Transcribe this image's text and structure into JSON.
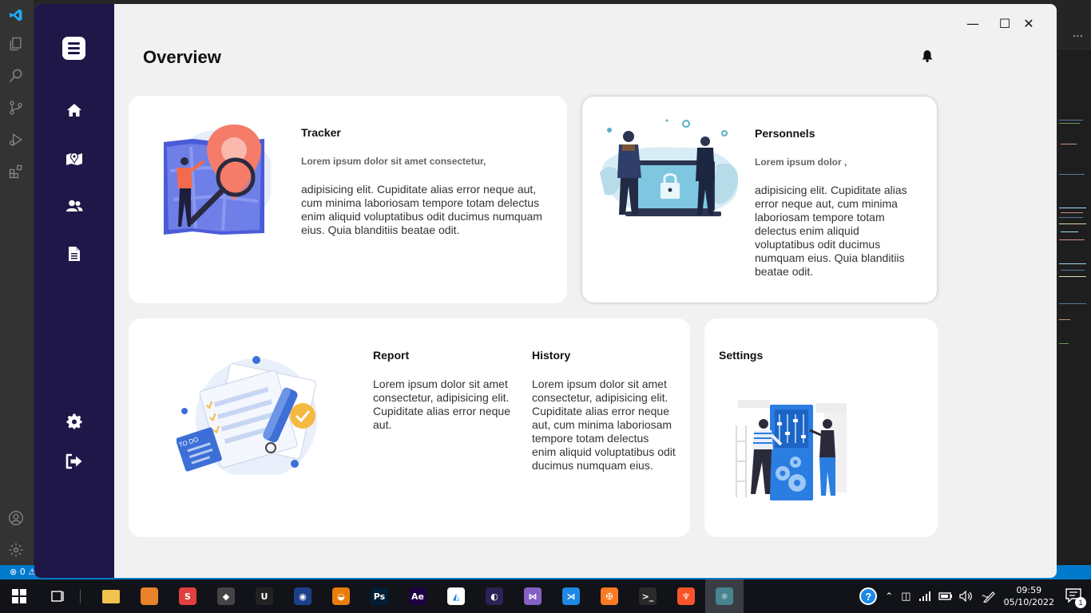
{
  "app": {
    "page_title": "Overview",
    "window_controls": {
      "minimize": "—",
      "maximize": "☐",
      "close": "✕"
    }
  },
  "sidebar": {
    "items": [
      {
        "name": "home",
        "icon": "home-icon"
      },
      {
        "name": "map",
        "icon": "map-icon"
      },
      {
        "name": "users",
        "icon": "users-icon"
      },
      {
        "name": "documents",
        "icon": "document-icon"
      },
      {
        "name": "settings",
        "icon": "gear-icon"
      },
      {
        "name": "logout",
        "icon": "logout-icon"
      }
    ]
  },
  "cards": {
    "tracker": {
      "title": "Tracker",
      "subtitle": "Lorem ipsum dolor sit amet consectetur,",
      "body": "adipisicing elit. Cupiditate alias error neque aut, cum minima laboriosam tempore totam delectus enim aliquid voluptatibus odit ducimus numquam eius. Quia blanditiis beatae odit."
    },
    "personnels": {
      "title": "Personnels",
      "subtitle": "Lorem ipsum dolor ,",
      "body": "adipisicing elit. Cupiditate alias error neque aut, cum minima laboriosam tempore totam delectus enim aliquid voluptatibus odit ducimus numquam eius. Quia blanditiis beatae odit."
    },
    "report": {
      "title": "Report",
      "body": "Lorem ipsum dolor sit amet consectetur, adipisicing elit. Cupiditate alias error neque aut.",
      "illustration_label": "TO DO"
    },
    "history": {
      "title": "History",
      "body": "Lorem ipsum dolor sit amet consectetur, adipisicing elit. Cupiditate alias error neque aut, cum minima laboriosam tempore totam delectus enim aliquid voluptatibus odit ducimus numquam eius."
    },
    "settings": {
      "title": "Settings"
    }
  },
  "statusbar": {
    "left": "⊗ 0 ⚠"
  },
  "taskbar": {
    "apps": [
      {
        "name": "file-explorer",
        "label": "",
        "color": "#f2c14e"
      },
      {
        "name": "fl-studio",
        "label": "",
        "color": "#e8832a"
      },
      {
        "name": "sublime",
        "label": "S",
        "color": "#e04040"
      },
      {
        "name": "unity",
        "label": "◆",
        "color": "#444"
      },
      {
        "name": "unreal",
        "label": "U",
        "color": "#222"
      },
      {
        "name": "cinema4d",
        "label": "◉",
        "color": "#1c3f8c"
      },
      {
        "name": "blender",
        "label": "◒",
        "color": "#e87d0d"
      },
      {
        "name": "photoshop",
        "label": "Ps",
        "color": "#001e36"
      },
      {
        "name": "after-effects",
        "label": "Ae",
        "color": "#1f0040"
      },
      {
        "name": "inkscape",
        "label": "◭",
        "color": "#ffffff"
      },
      {
        "name": "eclipse",
        "label": "◐",
        "color": "#2c2255"
      },
      {
        "name": "visual-studio",
        "label": "⋈",
        "color": "#8661c5"
      },
      {
        "name": "vscode",
        "label": "⋊",
        "color": "#1e88e5"
      },
      {
        "name": "xampp",
        "label": "✠",
        "color": "#fb7a24"
      },
      {
        "name": "terminal",
        "label": ">_",
        "color": "#2a2a2a"
      },
      {
        "name": "brave",
        "label": "♆",
        "color": "#fb542b"
      },
      {
        "name": "electron",
        "label": "⚛",
        "color": "#47848f"
      }
    ],
    "time": "09:59",
    "date": "05/10/2022",
    "notifications": "1"
  }
}
